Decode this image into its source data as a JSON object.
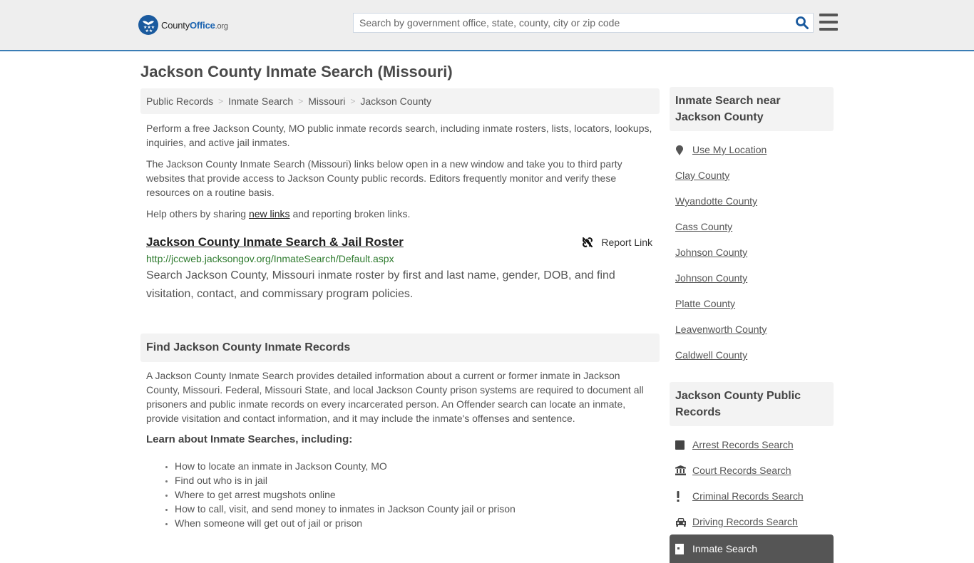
{
  "header": {
    "logo": {
      "county": "County",
      "office": "Office",
      "org": ".org"
    },
    "search": {
      "placeholder": "Search by government office, state, county, city or zip code",
      "value": ""
    },
    "icons": {
      "search": "search-icon",
      "menu": "hamburger-menu-icon"
    }
  },
  "page": {
    "title": "Jackson County Inmate Search (Missouri)"
  },
  "breadcrumb": [
    "Public Records",
    "Inmate Search",
    "Missouri",
    "Jackson County"
  ],
  "intro": {
    "p1": "Perform a free Jackson County, MO public inmate records search, including inmate rosters, lists, locators, lookups, inquiries, and active jail inmates.",
    "p2": "The Jackson County Inmate Search (Missouri) links below open in a new window and take you to third party websites that provide access to Jackson County public records. Editors frequently monitor and verify these resources on a routine basis.",
    "p3_before": "Help others by sharing ",
    "p3_link": "new links",
    "p3_after": " and reporting broken links."
  },
  "result": {
    "title": "Jackson County Inmate Search & Jail Roster",
    "report": "Report Link",
    "url": "http://jccweb.jacksongov.org/InmateSearch/Default.aspx",
    "description": "Search Jackson County, Missouri inmate roster by first and last name, gender, DOB, and find visitation, contact, and commissary program policies."
  },
  "find": {
    "heading": "Find Jackson County Inmate Records",
    "paragraph": "A Jackson County Inmate Search provides detailed information about a current or former inmate in Jackson County, Missouri. Federal, Missouri State, and local Jackson County prison systems are required to document all prisoners and public inmate records on every incarcerated person. An Offender search can locate an inmate, provide visitation and contact information, and it may include the inmate's offenses and sentence.",
    "learn": "Learn about Inmate Searches, including:",
    "bullets": [
      "How to locate an inmate in Jackson County, MO",
      "Find out who is in jail",
      "Where to get arrest mugshots online",
      "How to call, visit, and send money to inmates in Jackson County jail or prison",
      "When someone will get out of jail or prison"
    ]
  },
  "sidebar": {
    "near": {
      "heading": "Inmate Search near Jackson County",
      "use_location": "Use My Location",
      "counties": [
        "Clay County",
        "Wyandotte County",
        "Cass County",
        "Johnson County",
        "Johnson County",
        "Platte County",
        "Leavenworth County",
        "Caldwell County"
      ]
    },
    "records": {
      "heading": "Jackson County Public Records",
      "items": [
        {
          "label": "Arrest Records Search",
          "icon": "square-icon"
        },
        {
          "label": "Court Records Search",
          "icon": "courthouse-icon"
        },
        {
          "label": "Criminal Records Search",
          "icon": "exclamation-icon"
        },
        {
          "label": "Driving Records Search",
          "icon": "car-icon"
        },
        {
          "label": "Inmate Search",
          "icon": "door-icon",
          "active": true
        }
      ]
    }
  },
  "colors": {
    "brand_blue": "#1a63b0",
    "header_border": "#3a7db5",
    "url_green": "#2d7a2d",
    "active_bg": "#555555"
  }
}
